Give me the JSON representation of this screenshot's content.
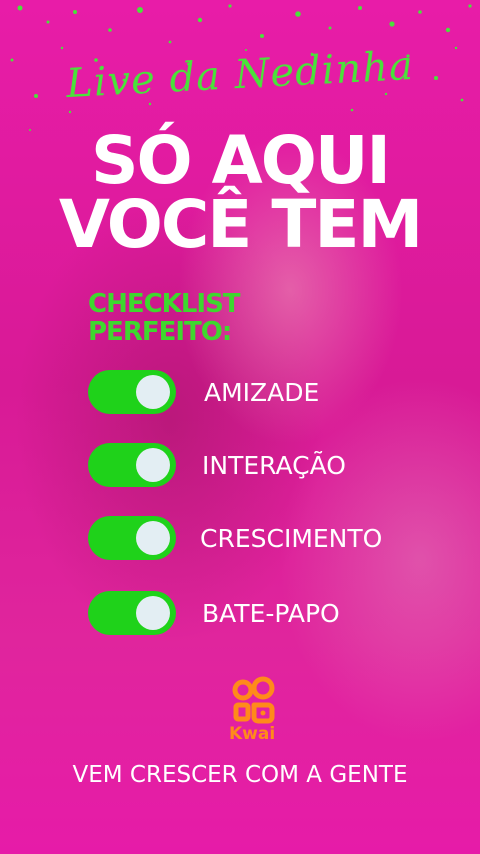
{
  "script_title": "Live da Nedinha",
  "headline": [
    "SÓ AQUI",
    "VOCÊ TEM"
  ],
  "checklist": {
    "title": [
      "CHECKLIST",
      "PERFEITO:"
    ],
    "items": [
      {
        "label": "AMIZADE",
        "on": true
      },
      {
        "label": "INTERAÇÃO",
        "on": true
      },
      {
        "label": "CRESCIMENTO",
        "on": true
      },
      {
        "label": "BATE-PAPO",
        "on": true
      }
    ]
  },
  "logo": {
    "word": "Kwai",
    "icon": "kwai-camera-icon",
    "color": "#ff8a1a"
  },
  "footer": "VEM CRESCER COM A GENTE",
  "colors": {
    "background": "#e018a0",
    "accent_green": "#1fd21a",
    "text": "#ffffff"
  }
}
